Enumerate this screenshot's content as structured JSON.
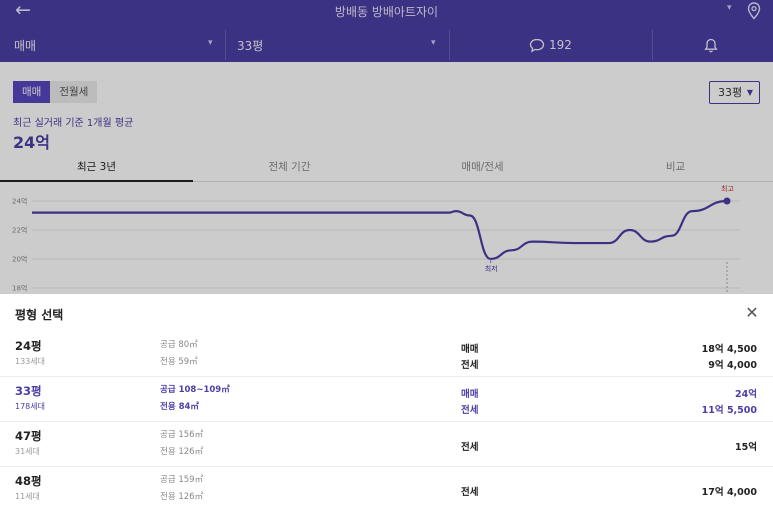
{
  "colors": {
    "brand": "#4b3fa6",
    "brand_light": "#5546c0",
    "line": "#4b3fa6"
  },
  "header": {
    "title": "방배동 방배아트자이",
    "back_icon": "arrow-left-icon",
    "location_icon": "map-pin-icon",
    "filter": {
      "trade_type": "매매",
      "size": "33평",
      "comments_icon": "speech-bubble-icon",
      "comments_count": "192",
      "alert_icon": "bell-icon"
    }
  },
  "summary": {
    "toggle": [
      "매매",
      "전월세"
    ],
    "size_select": "33평",
    "avg_label": "최근 실거래 기준 1개월 평균",
    "avg_value": "24억"
  },
  "tabs": [
    "최근 3년",
    "전체 기간",
    "매매/전세",
    "비교"
  ],
  "chart_data": {
    "type": "line",
    "y_ticks": [
      "24억",
      "22억",
      "20억",
      "18억"
    ],
    "annotations": {
      "max": "최고",
      "min": "최저"
    },
    "series": [
      {
        "values": [
          [
            0,
            23.2
          ],
          [
            0.6,
            23.2
          ],
          [
            0.61,
            23.3
          ],
          [
            0.63,
            23.0
          ],
          [
            0.66,
            20.0
          ],
          [
            0.69,
            20.6
          ],
          [
            0.72,
            21.2
          ],
          [
            0.78,
            21.1
          ],
          [
            0.83,
            21.1
          ],
          [
            0.86,
            22.0
          ],
          [
            0.89,
            21.2
          ],
          [
            0.92,
            21.6
          ],
          [
            0.95,
            23.3
          ],
          [
            1.0,
            24.0
          ]
        ]
      }
    ],
    "ylim": [
      17.2,
      25.2
    ],
    "grid": true
  },
  "sheet": {
    "title": "평형 선택",
    "close_icon": "close-icon",
    "options": [
      {
        "name": "24평",
        "households": "133세대",
        "supply": "공급 80㎡",
        "exclusive": "전용 59㎡",
        "trades": [
          {
            "type": "매매",
            "price": "18억 4,500"
          },
          {
            "type": "전세",
            "price": "9억 4,000"
          }
        ]
      },
      {
        "name": "33평",
        "households": "178세대",
        "supply": "공급 108~109㎡",
        "exclusive": "전용 84㎡",
        "selected": true,
        "trades": [
          {
            "type": "매매",
            "price": "24억"
          },
          {
            "type": "전세",
            "price": "11억 5,500"
          }
        ]
      },
      {
        "name": "47평",
        "households": "31세대",
        "supply": "공급 156㎡",
        "exclusive": "전용 126㎡",
        "trades": [
          {
            "type": "전세",
            "price": "15억"
          }
        ]
      },
      {
        "name": "48평",
        "households": "11세대",
        "supply": "공급 159㎡",
        "exclusive": "전용 126㎡",
        "trades": [
          {
            "type": "전세",
            "price": "17억 4,000"
          }
        ]
      }
    ]
  }
}
